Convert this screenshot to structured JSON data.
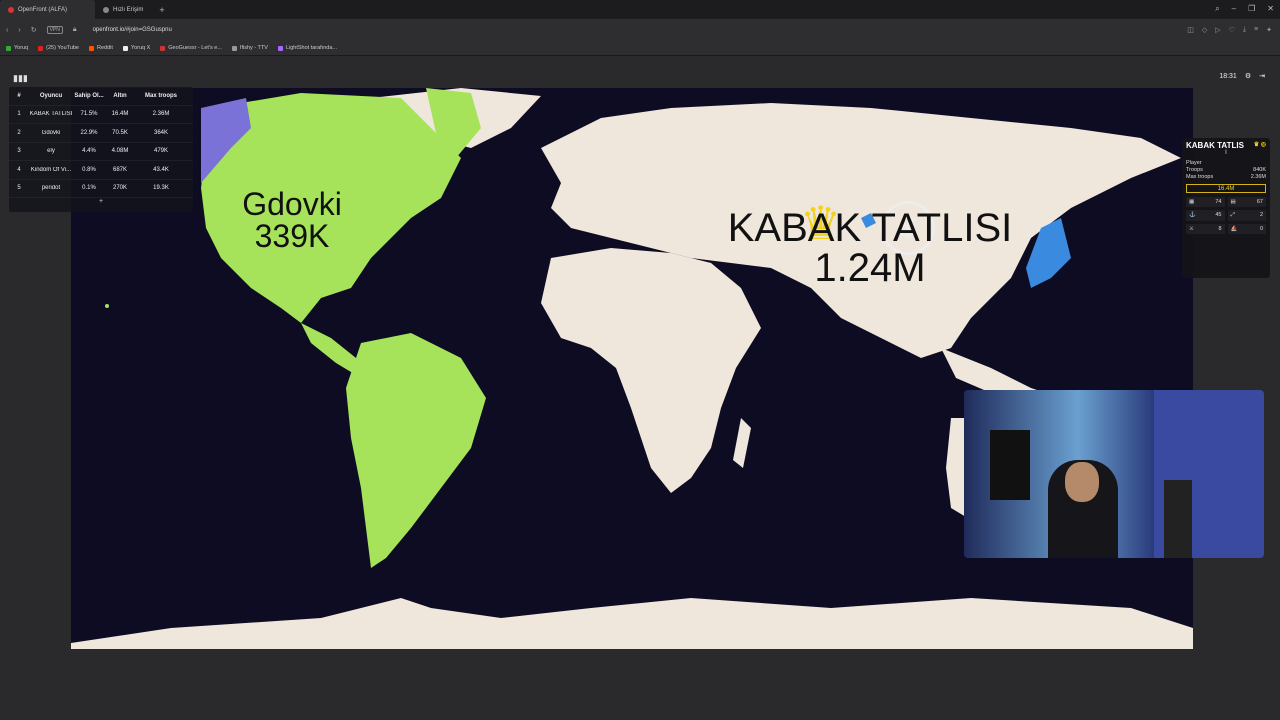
{
  "browser": {
    "tabs": [
      {
        "label": "OpenFront (ALFA)",
        "active": true
      },
      {
        "label": "Hızlı Erişim",
        "active": false
      }
    ],
    "url": "openfront.io/#join=GSGuspnu",
    "vpn_label": "VPN",
    "bookmarks": [
      "Yoruq",
      "(25) YouTube",
      "Reddit",
      "Yoruq X",
      "GeoGuessr - Let's e...",
      "Ifishy - TTV",
      "LightShot tarafında..."
    ]
  },
  "game": {
    "clock": "18:31",
    "leaderboard": {
      "headers": [
        "#",
        "Oyuncu",
        "Sahip Ol...",
        "Altın",
        "Max troops"
      ],
      "rows": [
        {
          "rank": "1",
          "player": "KABAK TATLISI",
          "owned": "71.5%",
          "gold": "16.4M",
          "max_troops": "2.36M"
        },
        {
          "rank": "2",
          "player": "Gdovki",
          "owned": "22.9%",
          "gold": "70.5K",
          "max_troops": "364K"
        },
        {
          "rank": "3",
          "player": "ely",
          "owned": "4.4%",
          "gold": "4.08M",
          "max_troops": "479K"
        },
        {
          "rank": "4",
          "player": "Kindom Of Vi...",
          "owned": "0.8%",
          "gold": "687K",
          "max_troops": "43.4K"
        },
        {
          "rank": "5",
          "player": "peridot",
          "owned": "0.1%",
          "gold": "270K",
          "max_troops": "19.3K"
        }
      ],
      "expand_label": "+"
    },
    "map_labels": {
      "gdovki_name": "Gdovki",
      "gdovki_troops": "339K",
      "kabak_name": "KABAK TATLISI",
      "kabak_troops": "1.24M"
    },
    "player_panel": {
      "name": "KABAK TATLIS",
      "subtitle": "I",
      "type": "Player",
      "troops_label": "Troops",
      "troops_value": "840K",
      "max_troops_label": "Max troops",
      "max_troops_value": "2.36M",
      "gold": "16.4M",
      "stats": [
        "74",
        "67",
        "45",
        "2",
        "8",
        "0"
      ]
    },
    "colors": {
      "ocean": "#0d0c22",
      "kabak_land": "#efe6dc",
      "gdovki_land": "#a6e35a",
      "ely_land": "#7b72d8",
      "crown": "#f4d21a"
    }
  }
}
